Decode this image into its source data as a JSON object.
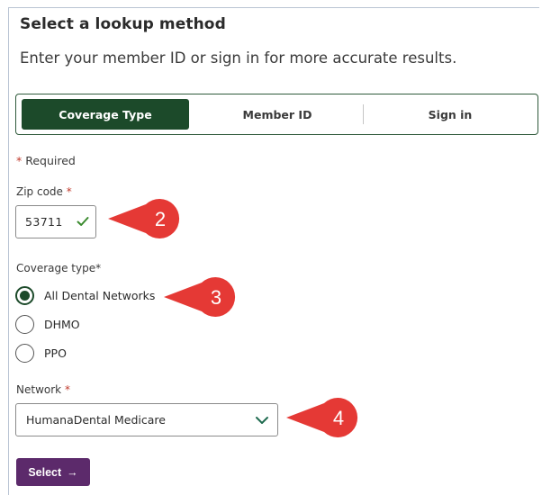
{
  "header": {
    "title": "Select a lookup method",
    "subtitle": "Enter your member ID or sign in for more accurate results."
  },
  "tabs": [
    {
      "label": "Coverage Type",
      "active": true
    },
    {
      "label": "Member ID",
      "active": false
    },
    {
      "label": "Sign in",
      "active": false
    }
  ],
  "form": {
    "required_asterisk": "*",
    "required_note": "Required",
    "zip": {
      "label": "Zip code",
      "asterisk": "*",
      "value": "53711",
      "valid_icon": "check-icon"
    },
    "coverage": {
      "label": "Coverage type",
      "asterisk": "*",
      "options": [
        {
          "label": "All Dental Networks",
          "selected": true
        },
        {
          "label": "DHMO",
          "selected": false
        },
        {
          "label": "PPO",
          "selected": false
        }
      ]
    },
    "network": {
      "label": "Network",
      "asterisk": "*",
      "value": "HumanaDental Medicare",
      "icon": "chevron-down-icon"
    },
    "submit": {
      "label": "Select",
      "arrow": "→"
    }
  },
  "callouts": [
    {
      "number": "2"
    },
    {
      "number": "3"
    },
    {
      "number": "4"
    }
  ],
  "colors": {
    "active_tab": "#1c4a2a",
    "tab_border": "#2f5a3b",
    "submit_button": "#5c2a6b",
    "callout": "#e53935",
    "check": "#3a8a2e",
    "asterisk": "#c0392b"
  }
}
